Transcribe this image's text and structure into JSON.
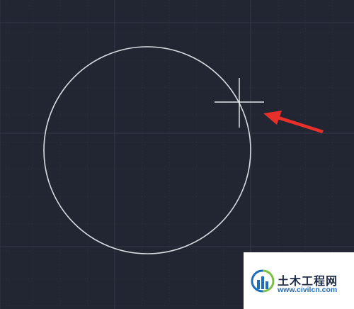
{
  "viewport": {
    "background_color": "#212632",
    "grid_minor_color": "#2a303b",
    "grid_major_color": "#313845",
    "circle_color": "#d9dde3",
    "crosshair_color": "#e8eaee",
    "arrow_color": "#e8302a"
  },
  "watermark": {
    "title": "土木工程网",
    "url": "www.civilcn.com"
  }
}
